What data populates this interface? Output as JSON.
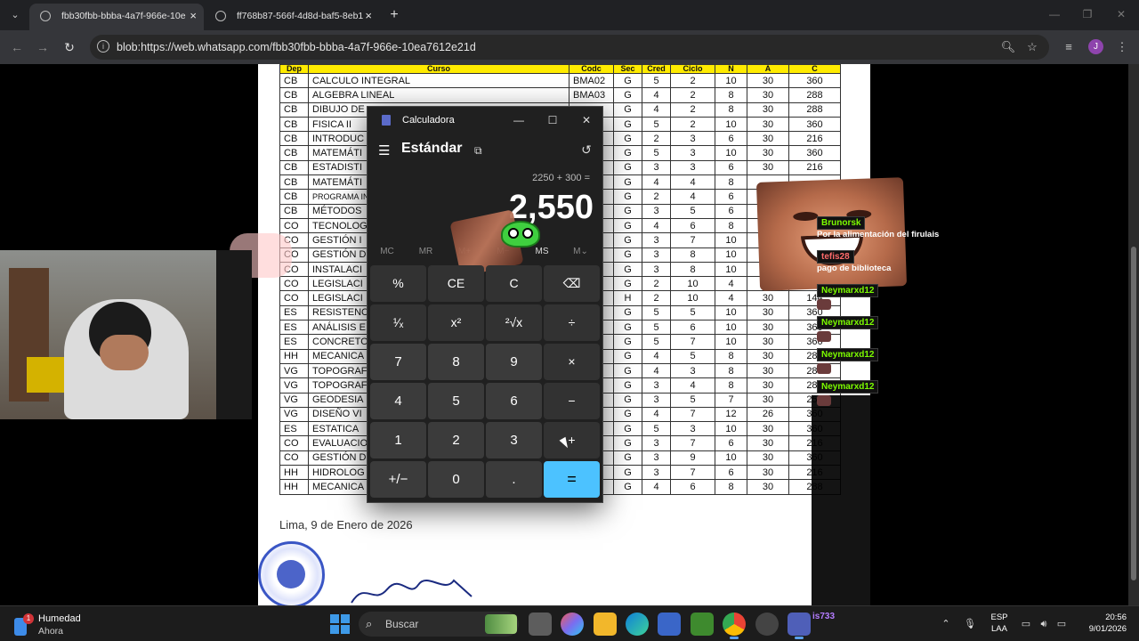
{
  "browser": {
    "tabs": [
      {
        "title": "fbb30fbb-bbba-4a7f-966e-10e",
        "active": true
      },
      {
        "title": "ff768b87-566f-4d8d-baf5-8eb1",
        "active": false
      }
    ],
    "url": "blob:https://web.whatsapp.com/fbb30fbb-bbba-4a7f-966e-10ea7612e21d",
    "profile_initial": "J"
  },
  "document": {
    "headers": [
      "Dep",
      "Curso",
      "Codc",
      "Sec",
      "Cred",
      "Ciclo",
      "N",
      "A",
      "C"
    ],
    "rows": [
      [
        "CB",
        "CALCULO INTEGRAL",
        "BMA02",
        "G",
        "5",
        "2",
        "10",
        "30",
        "360"
      ],
      [
        "CB",
        "ALGEBRA LINEAL",
        "BMA03",
        "G",
        "4",
        "2",
        "8",
        "30",
        "288"
      ],
      [
        "CB",
        "DIBUJO DE",
        "",
        "G",
        "4",
        "2",
        "8",
        "30",
        "288"
      ],
      [
        "CB",
        "FISICA II",
        "",
        "G",
        "5",
        "2",
        "10",
        "30",
        "360"
      ],
      [
        "CB",
        "INTRODUC",
        "",
        "G",
        "2",
        "3",
        "6",
        "30",
        "216"
      ],
      [
        "CB",
        "MATEMÁTI",
        "",
        "G",
        "5",
        "3",
        "10",
        "30",
        "360"
      ],
      [
        "CB",
        "ESTADISTI",
        "",
        "G",
        "3",
        "3",
        "6",
        "30",
        "216"
      ],
      [
        "CB",
        "MATEMÁTI",
        "",
        "G",
        "4",
        "4",
        "8",
        "",
        ""
      ],
      [
        "CB",
        "PROGRAMA INGENIERI",
        "",
        "G",
        "2",
        "4",
        "6",
        "",
        ""
      ],
      [
        "CB",
        "MÉTODOS",
        "",
        "G",
        "3",
        "5",
        "6",
        "",
        ""
      ],
      [
        "CO",
        "TECNOLOG",
        "",
        "G",
        "4",
        "6",
        "8",
        "",
        ""
      ],
      [
        "CO",
        "GESTIÓN I",
        "",
        "G",
        "3",
        "7",
        "10",
        "",
        ""
      ],
      [
        "CO",
        "GESTIÓN D",
        "",
        "G",
        "3",
        "8",
        "10",
        "",
        ""
      ],
      [
        "CO",
        "INSTALACI",
        "",
        "G",
        "3",
        "8",
        "10",
        "",
        ""
      ],
      [
        "CO",
        "LEGISLACI",
        "",
        "G",
        "2",
        "10",
        "4",
        "30",
        "144"
      ],
      [
        "CO",
        "LEGISLACI",
        "",
        "H",
        "2",
        "10",
        "4",
        "30",
        "144"
      ],
      [
        "ES",
        "RESISTENC",
        "",
        "G",
        "5",
        "5",
        "10",
        "30",
        "360"
      ],
      [
        "ES",
        "ANÁLISIS E",
        "",
        "G",
        "5",
        "6",
        "10",
        "30",
        "360"
      ],
      [
        "ES",
        "CONCRETO",
        "",
        "G",
        "5",
        "7",
        "10",
        "30",
        "360"
      ],
      [
        "HH",
        "MECANICA",
        "",
        "G",
        "4",
        "5",
        "8",
        "30",
        "288"
      ],
      [
        "VG",
        "TOPOGRAF",
        "",
        "G",
        "4",
        "3",
        "8",
        "30",
        "288"
      ],
      [
        "VG",
        "TOPOGRAF",
        "",
        "G",
        "3",
        "4",
        "8",
        "30",
        "288"
      ],
      [
        "VG",
        "GEODESIA",
        "",
        "G",
        "3",
        "5",
        "7",
        "30",
        "252"
      ],
      [
        "VG",
        "DISEÑO VI",
        "",
        "G",
        "4",
        "7",
        "12",
        "26",
        "360"
      ],
      [
        "ES",
        "ESTATICA",
        "",
        "G",
        "5",
        "3",
        "10",
        "30",
        "360"
      ],
      [
        "CO",
        "EVALUACIO",
        "",
        "G",
        "3",
        "7",
        "6",
        "30",
        "216"
      ],
      [
        "CO",
        "GESTIÓN D",
        "",
        "G",
        "3",
        "9",
        "10",
        "30",
        "360"
      ],
      [
        "HH",
        "HIDROLOG",
        "",
        "G",
        "3",
        "7",
        "6",
        "30",
        "216"
      ],
      [
        "HH",
        "MECANICA",
        "",
        "G",
        "4",
        "6",
        "8",
        "30",
        "288"
      ]
    ],
    "place_date": "Lima, 9 de Enero de 2026"
  },
  "calculator": {
    "app_title": "Calculadora",
    "mode": "Estándar",
    "expression": "2250 + 300 =",
    "display": "2,550",
    "memory_buttons": [
      "MC",
      "MR",
      "M+",
      "M−",
      "MS",
      "M⌄"
    ],
    "keys": [
      [
        "%",
        "CE",
        "C",
        "⌫"
      ],
      [
        "¹⁄ₓ",
        "x²",
        "²√x",
        "÷"
      ],
      [
        "7",
        "8",
        "9",
        "×"
      ],
      [
        "4",
        "5",
        "6",
        "−"
      ],
      [
        "1",
        "2",
        "3",
        "+"
      ],
      [
        "+/−",
        "0",
        ".",
        "="
      ]
    ]
  },
  "chat": [
    {
      "user": "Brunorsk",
      "user_color": "#7cfc00",
      "text": "Por la alimentación del firulais"
    },
    {
      "user": "tefis28",
      "user_color": "#ff6b6b",
      "text": "pago de biblioteca"
    },
    {
      "user": "Neymarxd12",
      "user_color": "#7cfc00",
      "text": ""
    },
    {
      "user": "Neymarxd12",
      "user_color": "#7cfc00",
      "text": ""
    },
    {
      "user": "Neymarxd12",
      "user_color": "#7cfc00",
      "text": ""
    },
    {
      "user": "Neymarxd12",
      "user_color": "#7cfc00",
      "text": ""
    }
  ],
  "taskbar": {
    "weather_badge": "1",
    "weather_title": "Humedad",
    "weather_sub": "Ahora",
    "search_label": "Buscar",
    "chat_tray_user": "is733",
    "lang_top": "ESP",
    "lang_bottom": "LAA",
    "time": "20:56",
    "date": "9/01/2026"
  }
}
